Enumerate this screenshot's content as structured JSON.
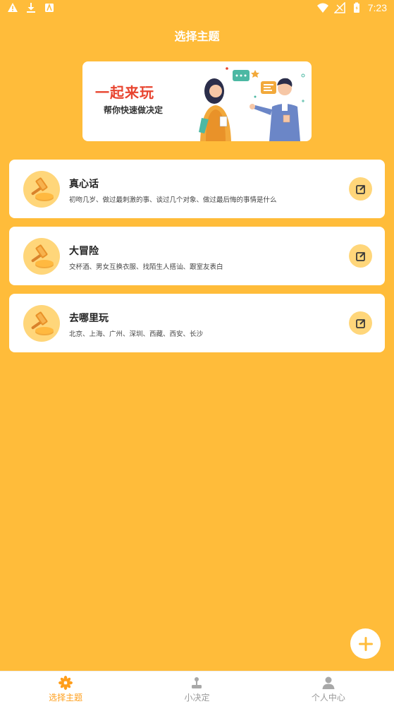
{
  "status_bar": {
    "time": "7:23"
  },
  "header": {
    "title": "选择主题"
  },
  "banner": {
    "line1": "一起来玩",
    "line2": "帮你快速做决定"
  },
  "themes": [
    {
      "title": "真心话",
      "description": "初吻几岁、做过最刺激的事、谈过几个对象、做过最后悔的事情是什么"
    },
    {
      "title": "大冒险",
      "description": "交杯酒、男女互换衣服、找陌生人搭讪、跟室友表白"
    },
    {
      "title": "去哪里玩",
      "description": "北京、上海、广州、深圳、西藏、西安、长沙"
    }
  ],
  "tabbar": {
    "items": [
      {
        "label": "选择主题",
        "icon": "flower-icon",
        "active": true
      },
      {
        "label": "小决定",
        "icon": "joystick-icon",
        "active": false
      },
      {
        "label": "个人中心",
        "icon": "person-icon",
        "active": false
      }
    ]
  },
  "colors": {
    "background": "#FFBC3A",
    "accent": "#FF9E1A",
    "icon_circle": "#FFD67A"
  }
}
